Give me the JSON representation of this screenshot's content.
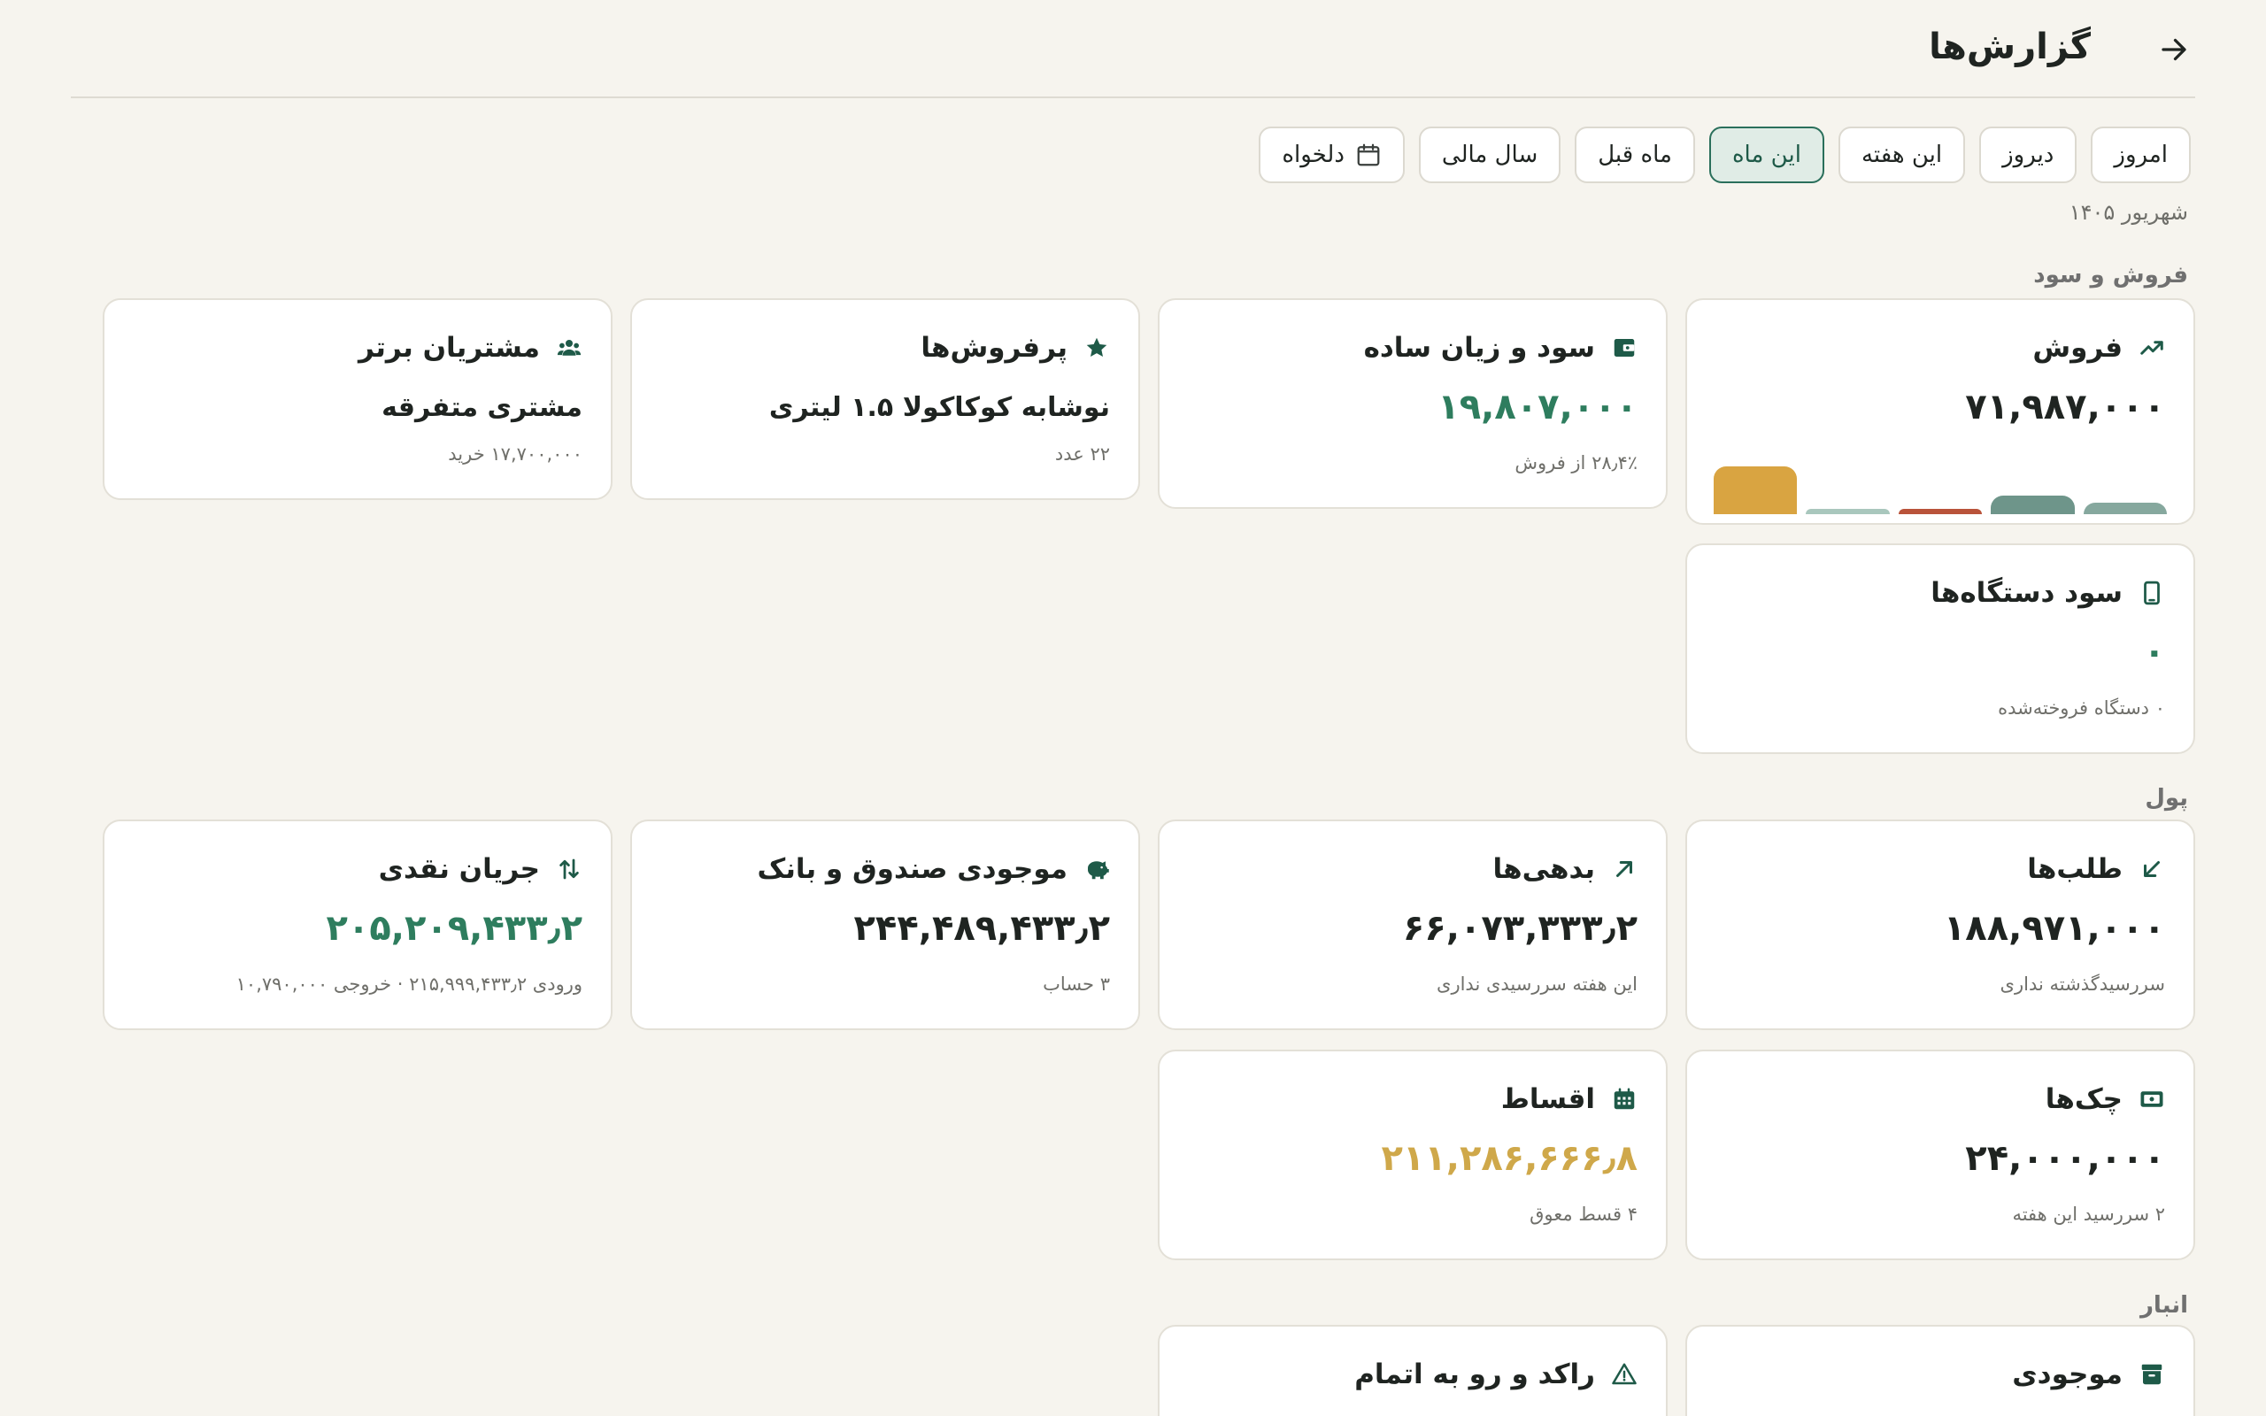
{
  "header": {
    "title": "گزارش‌ها",
    "back_icon": "arrow-right-icon"
  },
  "filters": [
    {
      "label": "امروز",
      "active": false
    },
    {
      "label": "دیروز",
      "active": false
    },
    {
      "label": "این هفته",
      "active": false
    },
    {
      "label": "این ماه",
      "active": true
    },
    {
      "label": "ماه قبل",
      "active": false
    },
    {
      "label": "سال مالی",
      "active": false
    },
    {
      "label": "دلخواه",
      "active": false,
      "icon": "calendar-icon"
    }
  ],
  "date_label": "شهریور ۱۴۰۵",
  "sections": {
    "sales_profit": "فروش و سود",
    "money": "پول",
    "inventory": "انبار"
  },
  "cards": {
    "sales": {
      "title": "فروش",
      "value": "۷۱,۹۸۷,۰۰۰",
      "icon": "trending-up-icon"
    },
    "profit": {
      "title": "سود و زیان ساده",
      "value": "۱۹,۸۰۷,۰۰۰",
      "sub": "۲۸٫۴٪ از فروش",
      "icon": "wallet-icon"
    },
    "bestsellers": {
      "title": "پرفروش‌ها",
      "value": "نوشابه کوکاکولا ۱.۵ لیتری",
      "sub": "۲۲ عدد",
      "icon": "star-icon"
    },
    "top_customers": {
      "title": "مشتریان برتر",
      "value": "مشتری متفرقه",
      "sub": "۱۷,۷۰۰,۰۰۰ خرید",
      "icon": "people-icon"
    },
    "device_profit": {
      "title": "سود دستگاه‌ها",
      "value": "۰",
      "sub": "۰ دستگاه فروخته‌شده",
      "icon": "phone-icon"
    },
    "receivables": {
      "title": "طلب‌ها",
      "value": "۱۸۸,۹۷۱,۰۰۰",
      "sub": "سررسیدگذشته نداری",
      "icon": "arrow-down-left-icon"
    },
    "debts": {
      "title": "بدهی‌ها",
      "value": "۶۶,۰۷۳,۳۳۳٫۲",
      "sub": "این هفته سررسیدی نداری",
      "icon": "arrow-up-right-icon"
    },
    "cash_bank": {
      "title": "موجودی صندوق و بانک",
      "value": "۲۴۴,۴۸۹,۴۳۳٫۲",
      "sub": "۳ حساب",
      "icon": "piggy-bank-icon"
    },
    "cash_flow": {
      "title": "جریان نقدی",
      "value": "۲۰۵,۲۰۹,۴۳۳٫۲",
      "sub": "ورودی ۲۱۵,۹۹۹,۴۳۳٫۲ · خروجی ۱۰,۷۹۰,۰۰۰",
      "icon": "swap-vertical-icon"
    },
    "cheques": {
      "title": "چک‌ها",
      "value": "۲۴,۰۰۰,۰۰۰",
      "sub": "۲ سررسید این هفته",
      "icon": "cheque-icon"
    },
    "installments": {
      "title": "اقساط",
      "value": "۲۱۱,۲۸۶,۶۶۶٫۸",
      "sub": "۴ قسط معوق",
      "icon": "calendar-grid-icon"
    },
    "stock": {
      "title": "موجودی",
      "icon": "archive-icon"
    },
    "stagnant": {
      "title": "راکد و رو به اتمام",
      "icon": "warning-icon"
    }
  },
  "sales_bars": [
    {
      "value": 1.0,
      "color": "#d9a441"
    },
    {
      "value": 0.12,
      "color": "#a9c7bd"
    },
    {
      "value": 0.12,
      "color": "#b9533a"
    },
    {
      "value": 0.38,
      "color": "#6e958a"
    },
    {
      "value": 0.24,
      "color": "#86a89e"
    }
  ],
  "colors": {
    "accent": "#2a6f5b",
    "positive": "#2e7d5e",
    "warning": "#cfa84a",
    "background": "#f6f4ee"
  }
}
